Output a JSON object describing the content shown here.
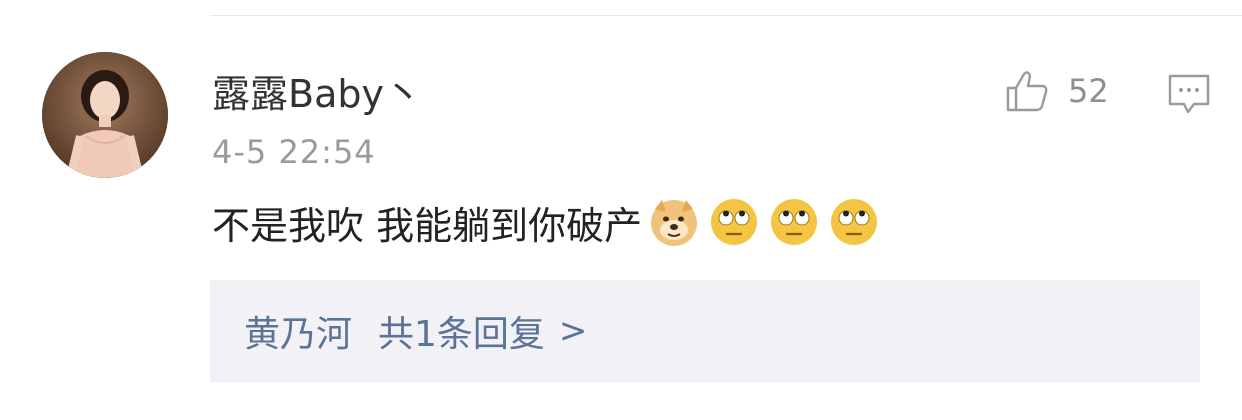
{
  "comment": {
    "username": "露露Baby丶",
    "timestamp": "4-5 22:54",
    "text": "不是我吹 我能躺到你破产",
    "emojis": [
      "doge-emoji",
      "eye-roll-emoji",
      "eye-roll-emoji",
      "eye-roll-emoji"
    ],
    "likes": "52"
  },
  "replies": {
    "author": "黄乃河",
    "count_label": "共1条回复",
    "chevron": ">"
  },
  "colors": {
    "link": "#5a7397",
    "name": "#333333",
    "meta": "#9a9a9a",
    "reply_bg": "#f2f2f6"
  }
}
